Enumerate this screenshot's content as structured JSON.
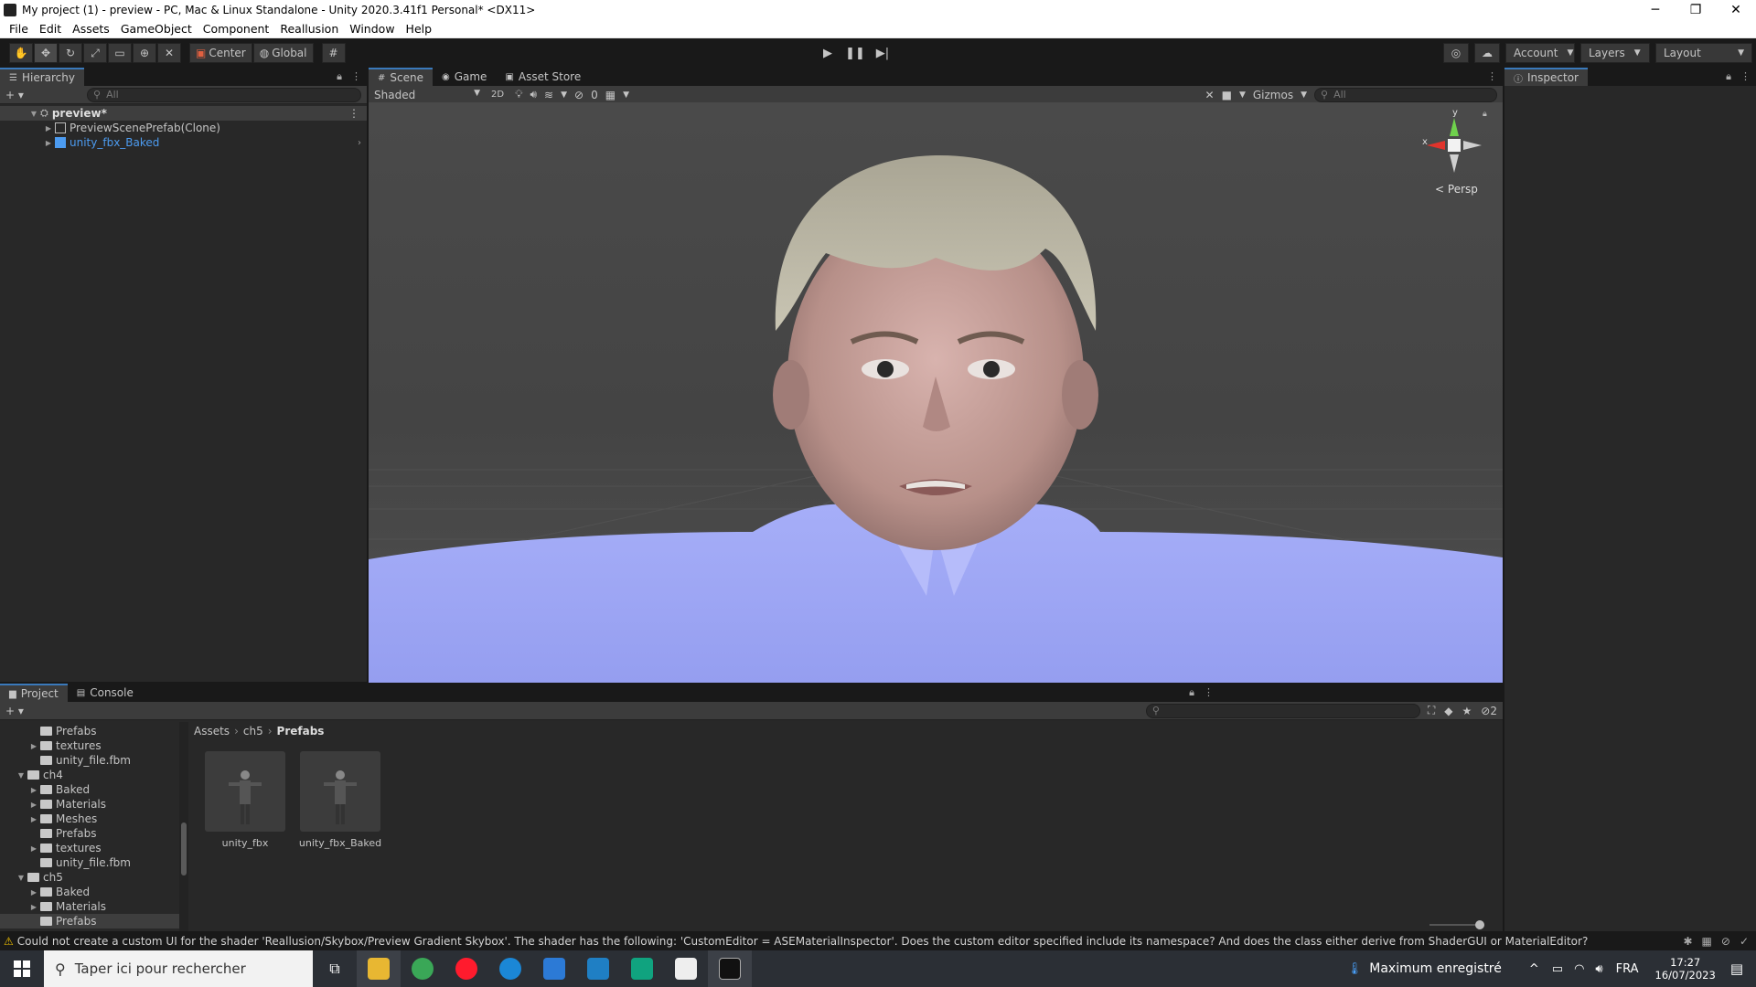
{
  "window": {
    "title": "My project (1) - preview - PC, Mac & Linux Standalone - Unity 2020.3.41f1 Personal* <DX11>",
    "controls": [
      "─",
      "❐",
      "✕"
    ]
  },
  "menu": [
    "File",
    "Edit",
    "Assets",
    "GameObject",
    "Component",
    "Reallusion",
    "Window",
    "Help"
  ],
  "toolbar": {
    "pivot": "Center",
    "space": "Global",
    "account": "Account",
    "layers": "Layers",
    "layout": "Layout"
  },
  "hierarchy": {
    "tab": "Hierarchy",
    "search_placeholder": "All",
    "scene": "preview*",
    "items": [
      {
        "label": "PreviewScenePrefab(Clone)"
      },
      {
        "label": "unity_fbx_Baked"
      }
    ]
  },
  "scene_tabs": [
    "Scene",
    "Game",
    "Asset Store"
  ],
  "scene_toolbar": {
    "shading": "Shaded",
    "mode2d": "2D",
    "hidden_count": "0",
    "gizmos": "Gizmos",
    "search_placeholder": "All",
    "persp": "Persp",
    "axis_x": "x",
    "axis_y": "y"
  },
  "inspector": {
    "tab": "Inspector"
  },
  "bottom_tabs": [
    "Project",
    "Console"
  ],
  "project": {
    "tree": [
      {
        "label": "Prefabs",
        "indent": 2,
        "arrow": ""
      },
      {
        "label": "textures",
        "indent": 2,
        "arrow": "▶"
      },
      {
        "label": "unity_file.fbm",
        "indent": 2,
        "arrow": ""
      },
      {
        "label": "ch4",
        "indent": 1,
        "arrow": "▼"
      },
      {
        "label": "Baked",
        "indent": 2,
        "arrow": "▶"
      },
      {
        "label": "Materials",
        "indent": 2,
        "arrow": "▶"
      },
      {
        "label": "Meshes",
        "indent": 2,
        "arrow": "▶"
      },
      {
        "label": "Prefabs",
        "indent": 2,
        "arrow": ""
      },
      {
        "label": "textures",
        "indent": 2,
        "arrow": "▶"
      },
      {
        "label": "unity_file.fbm",
        "indent": 2,
        "arrow": ""
      },
      {
        "label": "ch5",
        "indent": 1,
        "arrow": "▼"
      },
      {
        "label": "Baked",
        "indent": 2,
        "arrow": "▶"
      },
      {
        "label": "Materials",
        "indent": 2,
        "arrow": "▶"
      },
      {
        "label": "Prefabs",
        "indent": 2,
        "arrow": ""
      }
    ],
    "breadcrumb": [
      "Assets",
      "ch5",
      "Prefabs"
    ],
    "assets": [
      {
        "label": "unity_fbx"
      },
      {
        "label": "unity_fbx_Baked"
      }
    ],
    "hidden_packages": "2"
  },
  "status": {
    "message": "Could not create a custom UI for the shader 'Reallusion/Skybox/Preview Gradient Skybox'. The shader has the following: 'CustomEditor = ASEMaterialInspector'. Does the custom editor specified include its namespace? And does the class either derive from ShaderGUI or MaterialEditor?"
  },
  "taskbar": {
    "search_placeholder": "Taper ici pour rechercher",
    "notification": "Maximum enregistré",
    "language": "FRA",
    "time": "17:27",
    "date": "16/07/2023"
  },
  "colors": {
    "accent": "#3a79bb",
    "selection_text": "#4c9bf0",
    "shirt": "#a0a8f5",
    "scene_bg": "#464646"
  }
}
